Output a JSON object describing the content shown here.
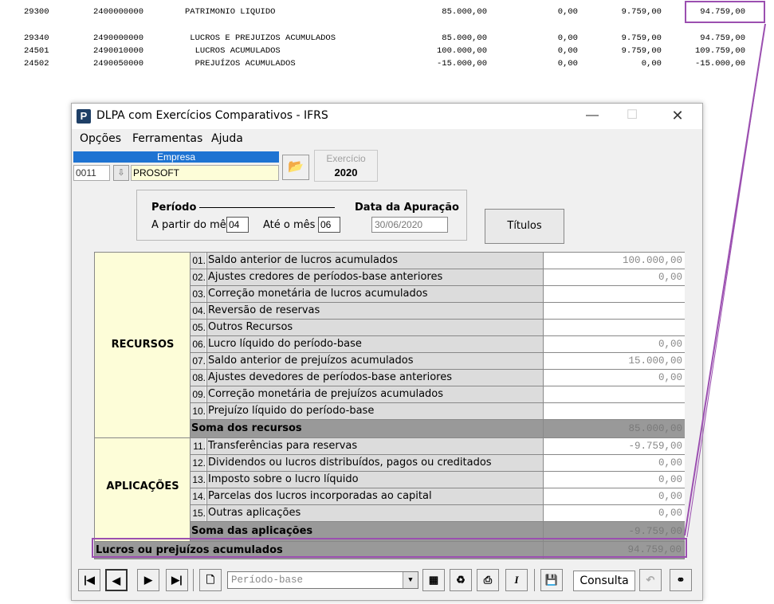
{
  "report": {
    "rows": [
      {
        "account": "29300",
        "code": "2400000000",
        "desc": "PATRIMONIO LIQUIDO",
        "v1": "85.000,00",
        "v2": "0,00",
        "v3": "9.759,00",
        "v4": "94.759,00"
      },
      {
        "account": "29340",
        "code": "2490000000",
        "desc": " LUCROS E PREJUIZOS ACUMULADOS",
        "v1": "85.000,00",
        "v2": "0,00",
        "v3": "9.759,00",
        "v4": "94.759,00"
      },
      {
        "account": "24501",
        "code": "2490010000",
        "desc": "  LUCROS ACUMULADOS",
        "v1": "100.000,00",
        "v2": "0,00",
        "v3": "9.759,00",
        "v4": "109.759,00"
      },
      {
        "account": "24502",
        "code": "2490050000",
        "desc": "  PREJUÍZOS ACUMULADOS",
        "v1": "-15.000,00",
        "v2": "0,00",
        "v3": "0,00",
        "v4": "-15.000,00"
      }
    ]
  },
  "window": {
    "title": "DLPA com Exercícios Comparativos - IFRS",
    "icon_letter": "P",
    "menu": [
      "Opções",
      "Ferramentas",
      "Ajuda"
    ]
  },
  "empresa": {
    "label": "Empresa",
    "code": "0011",
    "name": "PROSOFT"
  },
  "exercicio": {
    "label": "Exercício",
    "value": "2020"
  },
  "periodo": {
    "title": "Período",
    "from_label": "A partir do mês",
    "from_value": "04",
    "to_label": "Até o mês",
    "to_value": "06",
    "apuracao_label": "Data da Apuração",
    "apuracao_value": "30/06/2020"
  },
  "titulos_button": "Títulos",
  "grid": {
    "recursos_label": "RECURSOS",
    "aplicacoes_label": "APLICAÇÕES",
    "recursos": [
      {
        "num": "01.",
        "desc": "Saldo anterior de lucros acumulados",
        "value": "100.000,00"
      },
      {
        "num": "02.",
        "desc": "Ajustes credores de períodos-base anteriores",
        "value": "0,00"
      },
      {
        "num": "03.",
        "desc": "Correção monetária de lucros acumulados",
        "value": ""
      },
      {
        "num": "04.",
        "desc": "Reversão de reservas",
        "value": ""
      },
      {
        "num": "05.",
        "desc": "Outros Recursos",
        "value": ""
      },
      {
        "num": "06.",
        "desc": "Lucro líquido do período-base",
        "value": "0,00"
      },
      {
        "num": "07.",
        "desc": "Saldo anterior de prejuízos acumulados",
        "value": "15.000,00"
      },
      {
        "num": "08.",
        "desc": "Ajustes devedores de períodos-base anteriores",
        "value": "0,00"
      },
      {
        "num": "09.",
        "desc": "Correção monetária de prejuízos acumulados",
        "value": ""
      },
      {
        "num": "10.",
        "desc": "Prejuízo líquido do período-base",
        "value": ""
      }
    ],
    "soma_recursos": {
      "label": "Soma dos recursos",
      "value": "85.000,00"
    },
    "aplicacoes": [
      {
        "num": "11.",
        "desc": "Transferências para reservas",
        "value": "-9.759,00"
      },
      {
        "num": "12.",
        "desc": "Dividendos ou lucros distribuídos, pagos ou creditados",
        "value": "0,00"
      },
      {
        "num": "13.",
        "desc": "Imposto sobre o lucro líquido",
        "value": "0,00"
      },
      {
        "num": "14.",
        "desc": "Parcelas dos lucros incorporadas ao capital",
        "value": "0,00"
      },
      {
        "num": "15.",
        "desc": "Outras aplicações",
        "value": "0,00"
      }
    ],
    "soma_aplicacoes": {
      "label": "Soma das aplicações",
      "value": "-9.759,00"
    },
    "total": {
      "label": "Lucros ou prejuízos acumulados",
      "value": "94.759,00"
    }
  },
  "toolbar": {
    "select_placeholder": "Período-base",
    "mode": "Consulta"
  },
  "colors": {
    "highlight": "#9b4fb0",
    "empresa_header": "#1e73d2",
    "category_bg": "#fdfdd8",
    "sum_row_bg": "#999999"
  }
}
